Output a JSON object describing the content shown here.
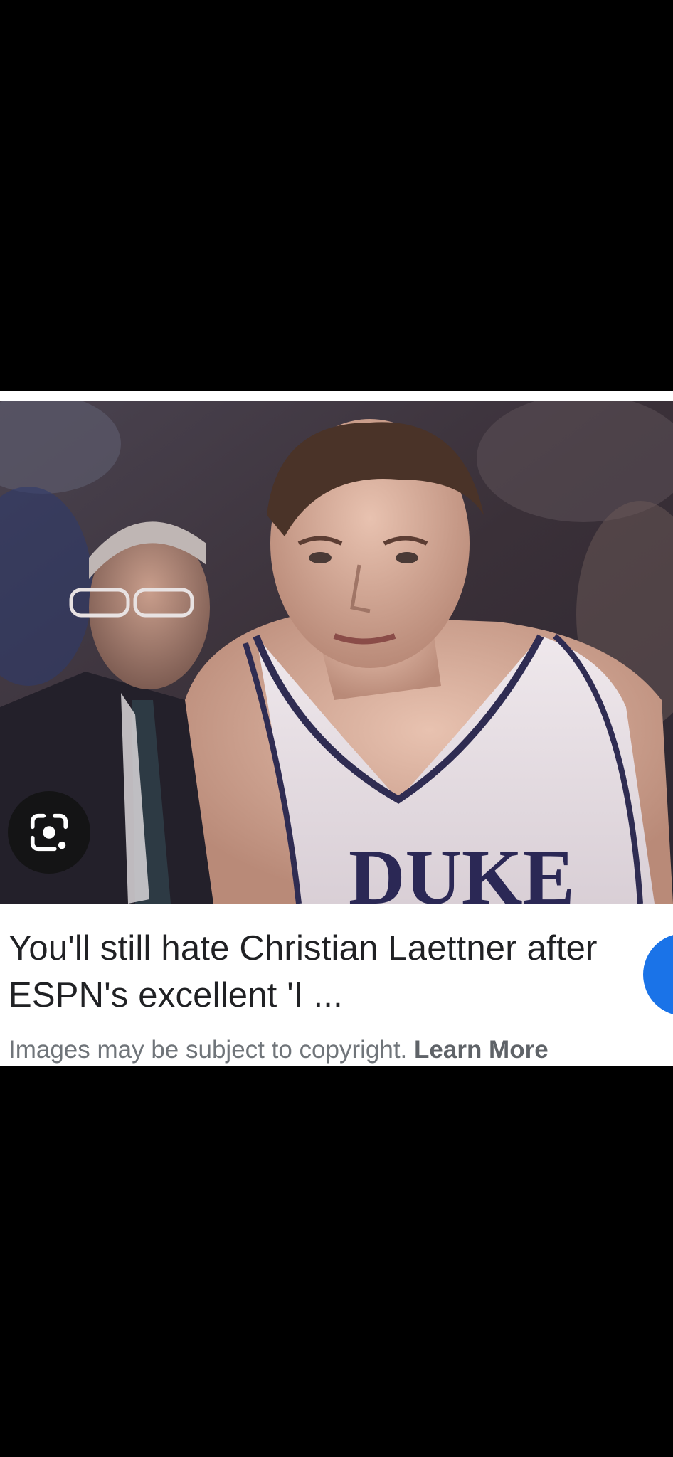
{
  "result": {
    "title": "You'll still hate Christian Laettner after ESPN's excellent 'I ...",
    "copyright_text": "Images may be subject to copyright.",
    "learn_more_label": "Learn More",
    "image_alt": "Duke basketball player in white jersey with coach behind him"
  },
  "icons": {
    "lens": "google-lens-icon",
    "visit": "visit-site-button"
  },
  "colors": {
    "accent_blue": "#1a73e8",
    "title_text": "#202124",
    "secondary_text": "#70757a",
    "background": "#000000",
    "card": "#ffffff"
  }
}
